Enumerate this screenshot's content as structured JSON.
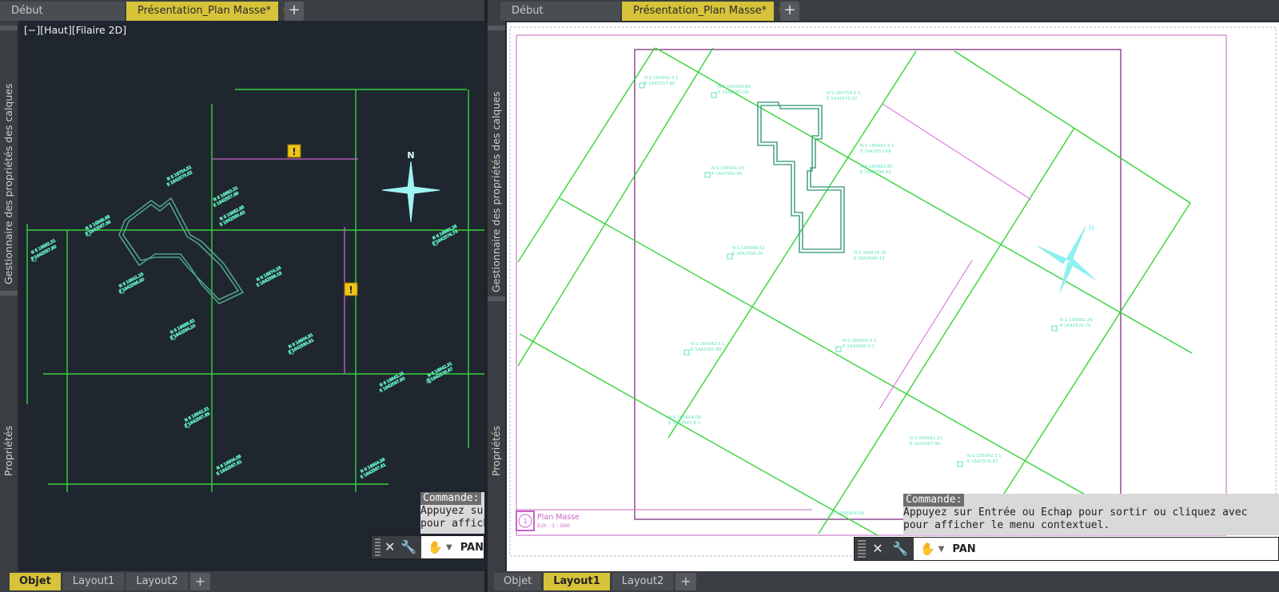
{
  "left": {
    "doc_tabs": [
      "Début",
      "Présentation_Plan Masse*"
    ],
    "viewport_label": "[−][Haut][Filaire 2D]",
    "palette_labels": [
      "Gestionnaire des propriétés des calques",
      "Propriétés"
    ],
    "command": {
      "label": "Commande:",
      "line1": "Appuyez sur",
      "line2": "pour affich",
      "input": "PAN"
    },
    "layout_tabs": [
      "Objet",
      "Layout1",
      "Layout2"
    ],
    "active_layout": "Objet"
  },
  "right": {
    "doc_tabs": [
      "Début",
      "Présentation_Plan Masse*"
    ],
    "palette_labels": [
      "Gestionnaire des propriétés des calques",
      "Propriétés"
    ],
    "title_block": {
      "title": "Plan Masse",
      "scale": "Ech : 1 : 500",
      "number": "1"
    },
    "command": {
      "label": "Commande:",
      "line1": "Appuyez sur Entrée ou Echap pour sortir ou cliquez avec",
      "line2": "pour afficher le menu contextuel.",
      "input": "PAN"
    },
    "layout_tabs": [
      "Objet",
      "Layout1",
      "Layout2"
    ],
    "active_layout": "Layout1"
  },
  "north_label": "N",
  "colors": {
    "accent": "#d7c33a",
    "geometry_green": "#35d435",
    "building": "#4fa388",
    "dimension": "#c765c7",
    "points": "#5fe3b9"
  }
}
